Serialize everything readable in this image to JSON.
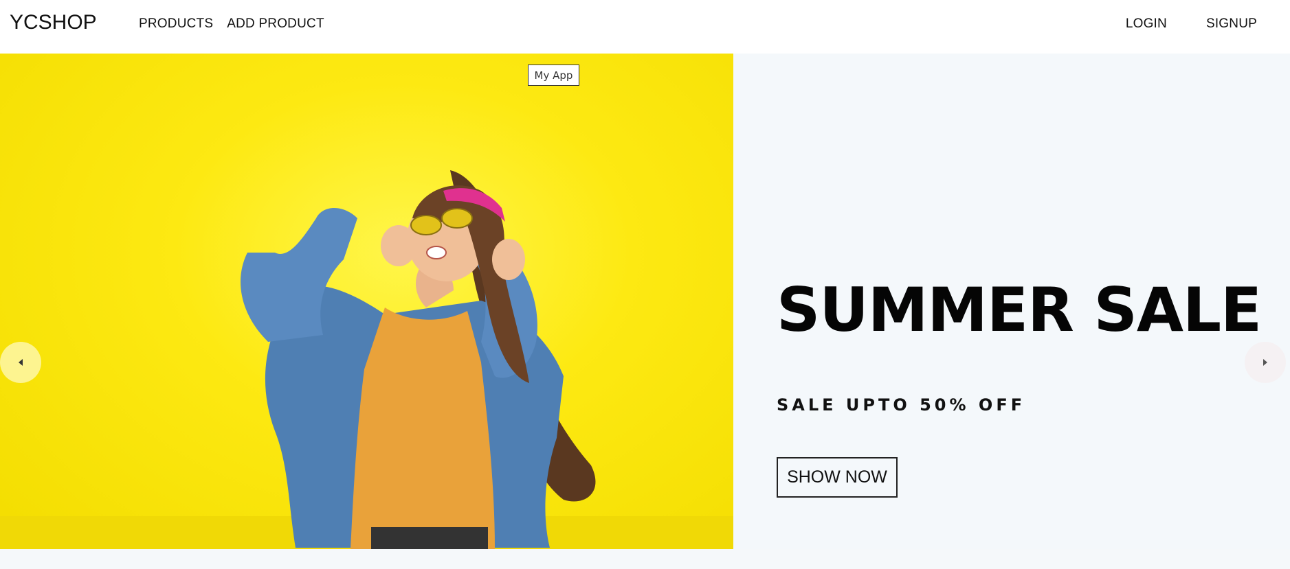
{
  "brand": {
    "name": "YCSHOP"
  },
  "nav": {
    "left_items": [
      {
        "label": "PRODUCTS"
      },
      {
        "label": "ADD PRODUCT"
      }
    ],
    "right_items": [
      {
        "label": "LOGIN"
      },
      {
        "label": "SIGNUP"
      }
    ]
  },
  "hero": {
    "image_tooltip": "My App",
    "title": "SUMMER SALE",
    "subtitle": "SALE UPTO 50% OFF",
    "cta_label": "SHOW NOW",
    "image_background_color": "#fde912"
  },
  "slider": {
    "prev_icon": "arrow-left-icon",
    "next_icon": "arrow-right-icon"
  }
}
